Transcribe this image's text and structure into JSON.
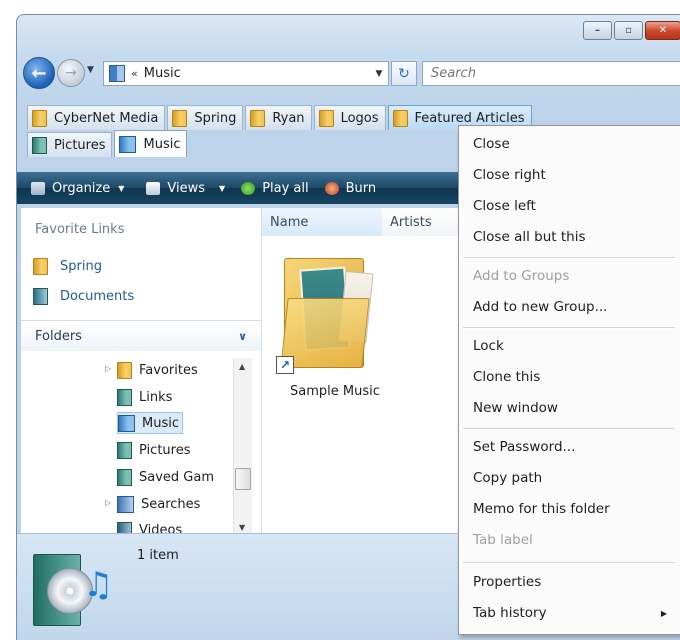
{
  "navigation": {
    "address_text": "Music",
    "address_chevrons": "«",
    "search_placeholder": "Search"
  },
  "tabs_row1": [
    {
      "label": "CyberNet Media"
    },
    {
      "label": "Spring"
    },
    {
      "label": "Ryan"
    },
    {
      "label": "Logos"
    },
    {
      "label": "Featured Articles"
    }
  ],
  "tabs_row2": [
    {
      "label": "Pictures"
    },
    {
      "label": "Music"
    }
  ],
  "toolbar": {
    "organize": "Organize",
    "views": "Views",
    "play_all": "Play all",
    "burn": "Burn"
  },
  "left_pane": {
    "favorite_links_heading": "Favorite Links",
    "favorite_links": [
      "Spring",
      "Documents"
    ],
    "folders_label": "Folders",
    "tree": [
      "Favorites",
      "Links",
      "Music",
      "Pictures",
      "Saved Gam",
      "Searches",
      "Videos"
    ]
  },
  "content": {
    "columns": [
      "Name",
      "Artists"
    ],
    "items": [
      {
        "label": "Sample Music"
      }
    ]
  },
  "details": {
    "count": "1 item"
  },
  "context_menu": {
    "close": "Close",
    "close_right": "Close right",
    "close_left": "Close left",
    "close_all_but_this": "Close all but this",
    "add_to_groups": "Add to Groups",
    "add_to_new_group": "Add to new Group...",
    "lock": "Lock",
    "clone_this": "Clone this",
    "new_window": "New window",
    "set_password": "Set Password...",
    "copy_path": "Copy path",
    "memo": "Memo for this folder",
    "tab_label": "Tab label",
    "properties": "Properties",
    "tab_history": "Tab history"
  },
  "colors": {
    "accent": "#1f5aa5",
    "toolbar": "#1d4866",
    "close_button": "#c9442a"
  }
}
